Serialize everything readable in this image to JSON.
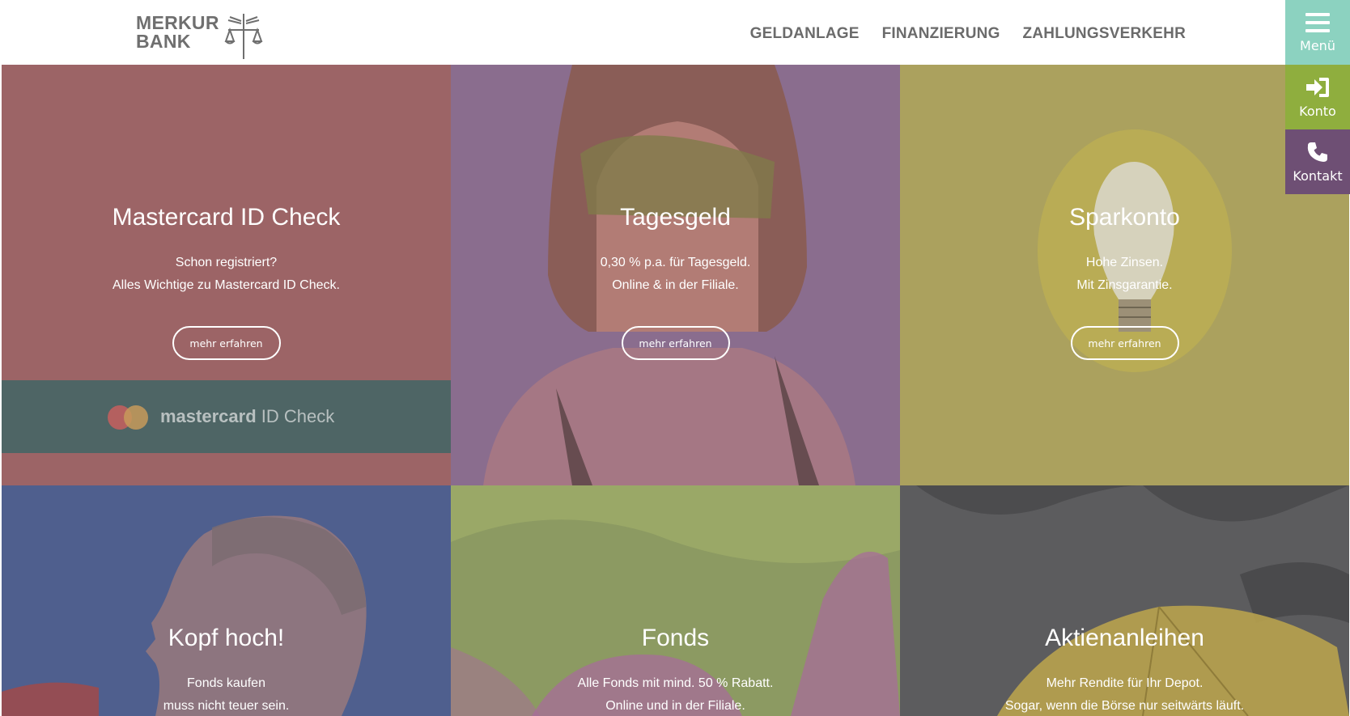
{
  "brand": {
    "line1": "MERKUR",
    "line2": "BANK"
  },
  "nav": {
    "items": [
      {
        "label": "GELDANLAGE"
      },
      {
        "label": "FINANZIERUNG"
      },
      {
        "label": "ZAHLUNGSVERKEHR"
      }
    ]
  },
  "side_tabs": {
    "menu": {
      "label": "Menü",
      "icon": "hamburger-icon",
      "color": "#8cd2c0"
    },
    "konto": {
      "label": "Konto",
      "icon": "sign-in-icon",
      "color": "#8fae3e"
    },
    "kontakt": {
      "label": "Kontakt",
      "icon": "phone-icon",
      "color": "#6e4f74"
    }
  },
  "tiles": [
    {
      "title": "Mastercard ID Check",
      "line1": "Schon registriert?",
      "line2": "Alles Wichtige zu Mastercard ID Check.",
      "button": "mehr erfahren",
      "overlay": "#9c6466",
      "image_brand": "mastercard",
      "image_caption": "ID Check"
    },
    {
      "title": "Tagesgeld",
      "line1": "0,30 % p.a. für Tagesgeld.",
      "line2": "Online & in der Filiale.",
      "button": "mehr erfahren",
      "overlay": "#8a6d8e"
    },
    {
      "title": "Sparkonto",
      "line1": "Hohe Zinsen.",
      "line2": "Mit Zinsgarantie.",
      "button": "mehr erfahren",
      "overlay": "#aba15e"
    },
    {
      "title": "Kopf hoch!",
      "line1": "Fonds kaufen",
      "line2": "muss nicht teuer sein.",
      "overlay": "#4f5f8e"
    },
    {
      "title": "Fonds",
      "line1": "Alle Fonds mit mind. 50 % Rabatt.",
      "line2": "Online und in der Filiale.",
      "overlay": "#8c9a62"
    },
    {
      "title": "Aktienanleihen",
      "line1": "Mehr Rendite für Ihr Depot.",
      "line2": "Sogar, wenn die Börse nur seitwärts läuft.",
      "overlay": "#5c5c5e"
    }
  ]
}
